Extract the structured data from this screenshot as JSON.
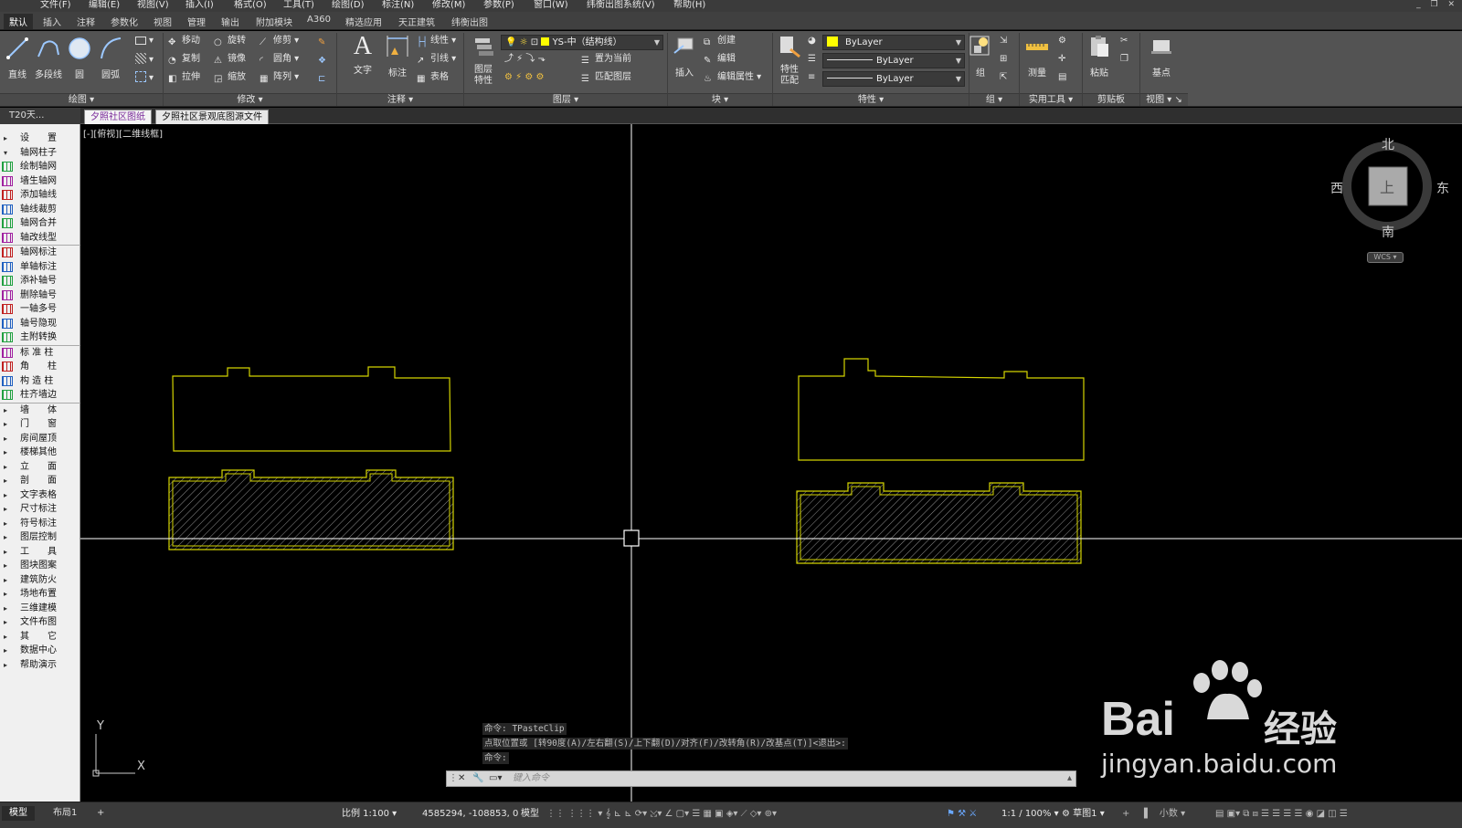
{
  "menu": [
    "文件(F)",
    "编辑(E)",
    "视图(V)",
    "插入(I)",
    "格式(O)",
    "工具(T)",
    "绘图(D)",
    "标注(N)",
    "修改(M)",
    "参数(P)",
    "窗口(W)",
    "纬衡出图系统(V)",
    "帮助(H)"
  ],
  "ribbon_tabs": [
    "默认",
    "插入",
    "注释",
    "参数化",
    "视图",
    "管理",
    "输出",
    "附加模块",
    "A360",
    "精选应用",
    "天正建筑",
    "纬衡出图"
  ],
  "ribbon": {
    "draw": {
      "title": "绘图 ▾",
      "line": "直线",
      "polyline": "多段线",
      "circle": "圆",
      "arc": "圆弧"
    },
    "modify": {
      "title": "修改 ▾",
      "move": "移动",
      "rotate": "旋转",
      "trim": "修剪",
      "copy": "复制",
      "mirror": "镜像",
      "fillet": "圆角",
      "stretch": "拉伸",
      "scale": "缩放",
      "array": "阵列"
    },
    "annotation": {
      "title": "注释 ▾",
      "text": "文字",
      "dimension": "标注",
      "linear": "线性",
      "leader": "引线",
      "table": "表格"
    },
    "layers": {
      "title": "图层 ▾",
      "props": "图层\n特性",
      "layer_name": "YS-中（结构线）",
      "make_current": "置为当前",
      "match_layer": "匹配图层"
    },
    "block": {
      "title": "块 ▾",
      "insert": "插入",
      "create": "创建",
      "edit": "编辑",
      "edit_attr": "编辑属性 ▾"
    },
    "properties": {
      "title": "特性 ▾",
      "match": "特性\n匹配",
      "color": "ByLayer",
      "linetype": "ByLayer",
      "lineweight": "ByLayer"
    },
    "groups": {
      "title": "组 ▾",
      "group": "组"
    },
    "utilities": {
      "title": "实用工具 ▾",
      "measure": "测量"
    },
    "clipboard": {
      "title": "剪贴板",
      "paste": "粘贴"
    },
    "view": {
      "title": "视图 ▾ ↘",
      "base": "基点"
    }
  },
  "file_tabs": {
    "t20": "T20天...",
    "tab1": "夕照社区图纸",
    "tab2": "夕照社区景观底图源文件"
  },
  "sidebar": [
    {
      "label": "设　　置",
      "type": "section",
      "arrow": "▸"
    },
    {
      "label": "轴网柱子",
      "type": "section",
      "arrow": "▾"
    },
    {
      "label": "绘制轴网",
      "type": "item"
    },
    {
      "label": "墙生轴网",
      "type": "item"
    },
    {
      "label": "添加轴线",
      "type": "item"
    },
    {
      "label": "轴线裁剪",
      "type": "item"
    },
    {
      "label": "轴网合并",
      "type": "item"
    },
    {
      "label": "轴改线型",
      "type": "item"
    },
    {
      "label": "轴网标注",
      "type": "item",
      "divider": true
    },
    {
      "label": "单轴标注",
      "type": "item"
    },
    {
      "label": "添补轴号",
      "type": "item"
    },
    {
      "label": "删除轴号",
      "type": "item"
    },
    {
      "label": "一轴多号",
      "type": "item"
    },
    {
      "label": "轴号隐现",
      "type": "item"
    },
    {
      "label": "主附转换",
      "type": "item"
    },
    {
      "label": "标 准 柱",
      "type": "item",
      "divider": true
    },
    {
      "label": "角　　柱",
      "type": "item"
    },
    {
      "label": "构 造 柱",
      "type": "item"
    },
    {
      "label": "柱齐墙边",
      "type": "item"
    },
    {
      "label": "墙　　体",
      "type": "section",
      "arrow": "▸",
      "divider": true
    },
    {
      "label": "门　　窗",
      "type": "section",
      "arrow": "▸"
    },
    {
      "label": "房间屋顶",
      "type": "section",
      "arrow": "▸"
    },
    {
      "label": "楼梯其他",
      "type": "section",
      "arrow": "▸"
    },
    {
      "label": "立　　面",
      "type": "section",
      "arrow": "▸"
    },
    {
      "label": "剖　　面",
      "type": "section",
      "arrow": "▸"
    },
    {
      "label": "文字表格",
      "type": "section",
      "arrow": "▸"
    },
    {
      "label": "尺寸标注",
      "type": "section",
      "arrow": "▸"
    },
    {
      "label": "符号标注",
      "type": "section",
      "arrow": "▸"
    },
    {
      "label": "图层控制",
      "type": "section",
      "arrow": "▸"
    },
    {
      "label": "工　　具",
      "type": "section",
      "arrow": "▸"
    },
    {
      "label": "图块图案",
      "type": "section",
      "arrow": "▸"
    },
    {
      "label": "建筑防火",
      "type": "section",
      "arrow": "▸"
    },
    {
      "label": "场地布置",
      "type": "section",
      "arrow": "▸"
    },
    {
      "label": "三维建模",
      "type": "section",
      "arrow": "▸"
    },
    {
      "label": "文件布图",
      "type": "section",
      "arrow": "▸"
    },
    {
      "label": "其　　它",
      "type": "section",
      "arrow": "▸"
    },
    {
      "label": "数据中心",
      "type": "section",
      "arrow": "▸"
    },
    {
      "label": "帮助演示",
      "type": "section",
      "arrow": "▸"
    }
  ],
  "viewport": {
    "label": "[-][俯视][二维线框]"
  },
  "viewcube": {
    "north": "北",
    "south": "南",
    "east": "东",
    "west": "西",
    "top": "上",
    "wcs": "WCS ▾"
  },
  "ucs": {
    "x": "X",
    "y": "Y"
  },
  "command": {
    "history": [
      "命令: TPasteClip",
      "点取位置或 [转90度(A)/左右翻(S)/上下翻(D)/对齐(F)/改转角(R)/改基点(T)]<退出>:",
      "命令:"
    ],
    "placeholder": "键入命令"
  },
  "status": {
    "model_tab": "模型",
    "layout_tab": "布局1",
    "add": "+",
    "scale": "比例 1:100 ▾",
    "coords": "4585294, -108853, 0",
    "model": "模型",
    "anno_scale": "1:1 / 100% ▾",
    "workspace": "草图1 ▾",
    "units": "小数"
  },
  "watermark": {
    "brand": "Bai",
    "brand2": "经验",
    "url": "jingyan.baidu.com"
  },
  "colors": {
    "outline": "#d4d400",
    "hatch": "#9a9a9a",
    "crosshair": "#ffffff"
  }
}
